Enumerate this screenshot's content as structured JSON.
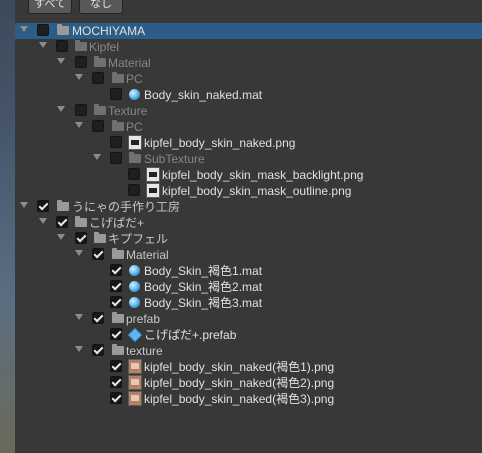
{
  "buttons": {
    "all": "すべて",
    "none": "なし"
  },
  "tree": [
    {
      "label": "MOCHIYAMA",
      "type": "folder",
      "checked": false,
      "selected": true
    },
    {
      "label": "Kipfel",
      "type": "folder",
      "checked": false
    },
    {
      "label": "Material",
      "type": "folder",
      "checked": false
    },
    {
      "label": "PC",
      "type": "folder",
      "checked": false
    },
    {
      "label": "Body_skin_naked.mat",
      "type": "material",
      "checked": false
    },
    {
      "label": "Texture",
      "type": "folder",
      "checked": false
    },
    {
      "label": "PC",
      "type": "folder",
      "checked": false
    },
    {
      "label": "kipfel_body_skin_naked.png",
      "type": "png",
      "checked": false
    },
    {
      "label": "SubTexture",
      "type": "folder",
      "checked": false
    },
    {
      "label": "kipfel_body_skin_mask_backlight.png",
      "type": "png",
      "checked": false
    },
    {
      "label": "kipfel_body_skin_mask_outline.png",
      "type": "png",
      "checked": false
    },
    {
      "label": "うにゃの手作り工房",
      "type": "folder",
      "checked": true
    },
    {
      "label": "こげぱだ+",
      "type": "folder",
      "checked": true
    },
    {
      "label": "キプフェル",
      "type": "folder",
      "checked": true
    },
    {
      "label": "Material",
      "type": "folder",
      "checked": true
    },
    {
      "label": "Body_Skin_褐色1.mat",
      "type": "material",
      "checked": true
    },
    {
      "label": "Body_Skin_褐色2.mat",
      "type": "material",
      "checked": true
    },
    {
      "label": "Body_Skin_褐色3.mat",
      "type": "material",
      "checked": true
    },
    {
      "label": "prefab",
      "type": "folder",
      "checked": true
    },
    {
      "label": "こげぱだ+.prefab",
      "type": "prefab",
      "checked": true
    },
    {
      "label": "texture",
      "type": "folder",
      "checked": true
    },
    {
      "label": "kipfel_body_skin_naked(褐色1).png",
      "type": "png",
      "checked": true
    },
    {
      "label": "kipfel_body_skin_naked(褐色2).png",
      "type": "png",
      "checked": true
    },
    {
      "label": "kipfel_body_skin_naked(褐色3).png",
      "type": "png",
      "checked": true
    }
  ]
}
